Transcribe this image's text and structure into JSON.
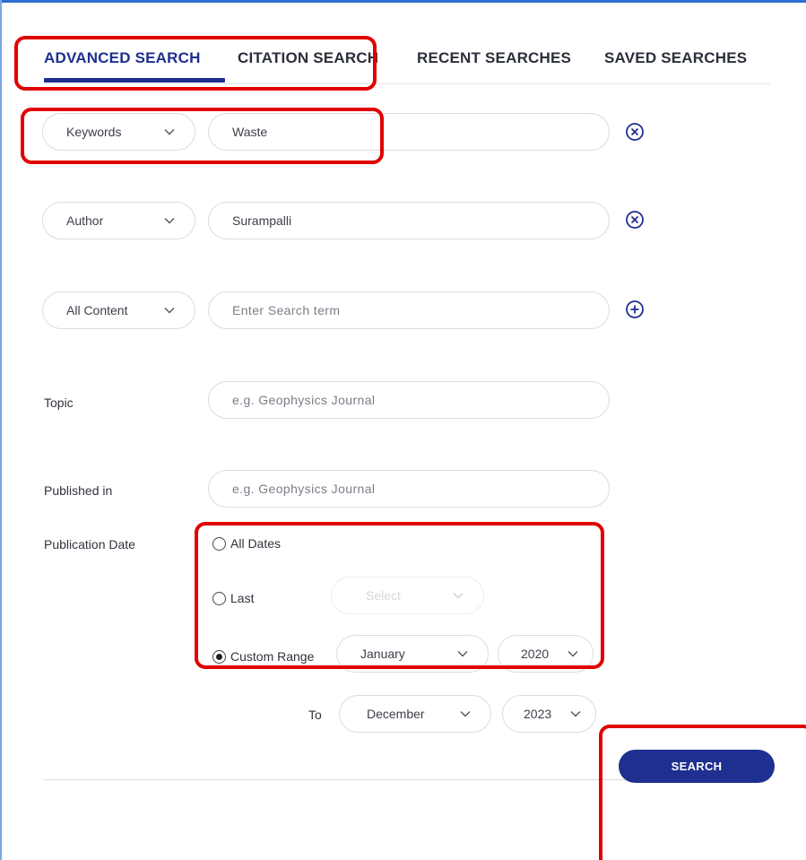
{
  "tabs": [
    {
      "label": "ADVANCED SEARCH",
      "active": true
    },
    {
      "label": "CITATION SEARCH",
      "active": false
    },
    {
      "label": "RECENT SEARCHES",
      "active": false
    },
    {
      "label": "SAVED SEARCHES",
      "active": false
    }
  ],
  "search_rows": [
    {
      "field": "Keywords",
      "value": "Waste",
      "action_icon": "close-circle-icon"
    },
    {
      "field": "Author",
      "value": "Surampalli",
      "action_icon": "close-circle-icon"
    },
    {
      "field": "All Content",
      "placeholder": "Enter Search term",
      "action_icon": "plus-circle-icon"
    }
  ],
  "topic": {
    "label": "Topic",
    "placeholder": "e.g. Geophysics Journal"
  },
  "published_in": {
    "label": "Published in",
    "placeholder": "e.g. Geophysics Journal"
  },
  "publication_date": {
    "label": "Publication Date",
    "options": [
      {
        "label": "All Dates",
        "selected": false
      },
      {
        "label": "Last",
        "selected": false
      },
      {
        "label": "Custom Range",
        "selected": true
      }
    ],
    "last_select": "Select",
    "from_month": "January",
    "from_year": "2020",
    "to_label": "To",
    "to_month": "December",
    "to_year": "2023"
  },
  "search_button": "SEARCH",
  "colors": {
    "accent": "#1e2f8f",
    "highlight": "#e10000",
    "border": "#dcdcdc"
  }
}
